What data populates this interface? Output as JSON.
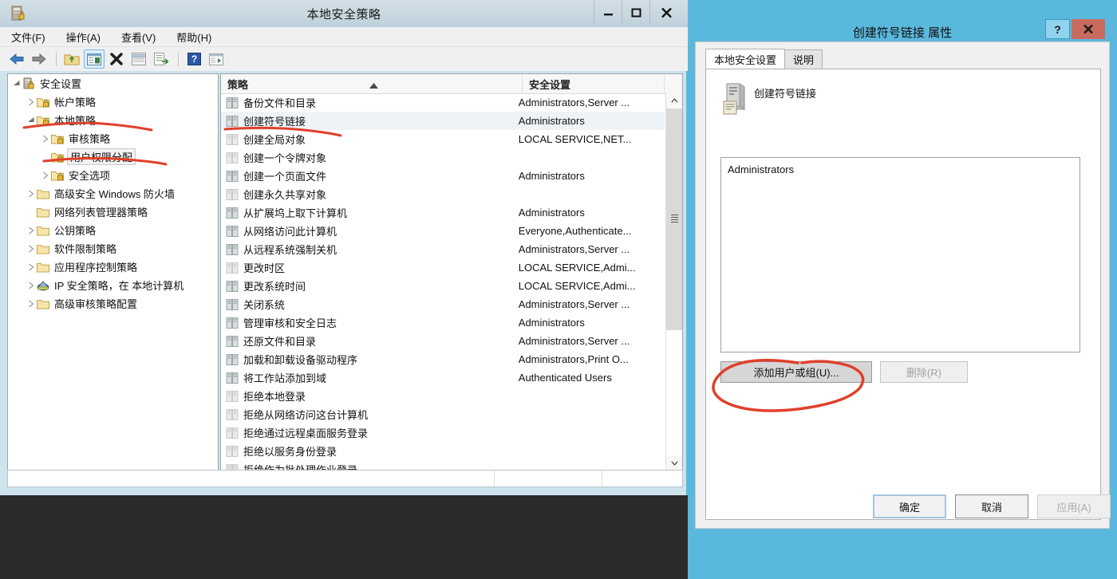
{
  "main_window": {
    "title": "本地安全策略",
    "title_icon": "security-policy-icon",
    "controls": {
      "minimize": "—",
      "maximize": "❐",
      "close": "✕"
    },
    "menu": [
      {
        "label": "文件(F)"
      },
      {
        "label": "操作(A)"
      },
      {
        "label": "查看(V)"
      },
      {
        "label": "帮助(H)"
      }
    ],
    "toolbar": [
      {
        "name": "back-icon"
      },
      {
        "name": "forward-icon"
      },
      {
        "name": "up-folder-icon"
      },
      {
        "name": "show-hide-tree-icon"
      },
      {
        "name": "delete-icon"
      },
      {
        "name": "properties-icon"
      },
      {
        "name": "export-list-icon"
      },
      {
        "name": "help-icon"
      },
      {
        "name": "show-action-pane-icon"
      }
    ],
    "tree": [
      {
        "label": "安全设置",
        "level": 0,
        "twisty": "expanded",
        "icon": "security-settings-icon",
        "selected": false
      },
      {
        "label": "帐户策略",
        "level": 1,
        "twisty": "collapsed",
        "icon": "policy-folder-icon",
        "selected": false
      },
      {
        "label": "本地策略",
        "level": 1,
        "twisty": "expanded",
        "icon": "policy-folder-icon",
        "selected": false
      },
      {
        "label": "审核策略",
        "level": 2,
        "twisty": "collapsed",
        "icon": "policy-folder-icon",
        "selected": false
      },
      {
        "label": "用户权限分配",
        "level": 2,
        "twisty": "none",
        "icon": "policy-folder-icon",
        "selected": true
      },
      {
        "label": "安全选项",
        "level": 2,
        "twisty": "collapsed",
        "icon": "policy-folder-icon",
        "selected": false
      },
      {
        "label": "高级安全 Windows 防火墙",
        "level": 1,
        "twisty": "collapsed",
        "icon": "folder-icon",
        "selected": false
      },
      {
        "label": "网络列表管理器策略",
        "level": 1,
        "twisty": "none",
        "icon": "folder-icon",
        "selected": false
      },
      {
        "label": "公钥策略",
        "level": 1,
        "twisty": "collapsed",
        "icon": "folder-icon",
        "selected": false
      },
      {
        "label": "软件限制策略",
        "level": 1,
        "twisty": "collapsed",
        "icon": "folder-icon",
        "selected": false
      },
      {
        "label": "应用程序控制策略",
        "level": 1,
        "twisty": "collapsed",
        "icon": "folder-icon",
        "selected": false
      },
      {
        "label": "IP 安全策略，在 本地计算机",
        "level": 1,
        "twisty": "collapsed",
        "icon": "ip-security-icon",
        "selected": false
      },
      {
        "label": "高级审核策略配置",
        "level": 1,
        "twisty": "collapsed",
        "icon": "folder-icon",
        "selected": false
      }
    ],
    "list": {
      "columns": [
        "策略",
        "安全设置"
      ],
      "sort": {
        "column": "策略",
        "direction": "ascending"
      },
      "rows": [
        {
          "policy": "备份文件和目录",
          "setting": "Administrators,Server ...",
          "icon": "policy-set-icon",
          "selected": false
        },
        {
          "policy": "创建符号链接",
          "setting": "Administrators",
          "icon": "policy-set-icon",
          "selected": true
        },
        {
          "policy": "创建全局对象",
          "setting": "LOCAL SERVICE,NET...",
          "icon": "policy-empty-icon",
          "selected": false
        },
        {
          "policy": "创建一个令牌对象",
          "setting": "",
          "icon": "policy-empty-icon",
          "selected": false
        },
        {
          "policy": "创建一个页面文件",
          "setting": "Administrators",
          "icon": "policy-set-icon",
          "selected": false
        },
        {
          "policy": "创建永久共享对象",
          "setting": "",
          "icon": "policy-empty-icon",
          "selected": false
        },
        {
          "policy": "从扩展坞上取下计算机",
          "setting": "Administrators",
          "icon": "policy-set-icon",
          "selected": false
        },
        {
          "policy": "从网络访问此计算机",
          "setting": "Everyone,Authenticate...",
          "icon": "policy-set-icon",
          "selected": false
        },
        {
          "policy": "从远程系统强制关机",
          "setting": "Administrators,Server ...",
          "icon": "policy-set-icon",
          "selected": false
        },
        {
          "policy": "更改时区",
          "setting": "LOCAL SERVICE,Admi...",
          "icon": "policy-empty-icon",
          "selected": false
        },
        {
          "policy": "更改系统时间",
          "setting": "LOCAL SERVICE,Admi...",
          "icon": "policy-set-icon",
          "selected": false
        },
        {
          "policy": "关闭系统",
          "setting": "Administrators,Server ...",
          "icon": "policy-set-icon",
          "selected": false
        },
        {
          "policy": "管理审核和安全日志",
          "setting": "Administrators",
          "icon": "policy-set-icon",
          "selected": false
        },
        {
          "policy": "还原文件和目录",
          "setting": "Administrators,Server ...",
          "icon": "policy-set-icon",
          "selected": false
        },
        {
          "policy": "加载和卸载设备驱动程序",
          "setting": "Administrators,Print O...",
          "icon": "policy-set-icon",
          "selected": false
        },
        {
          "policy": "将工作站添加到域",
          "setting": "Authenticated Users",
          "icon": "policy-set-icon",
          "selected": false
        },
        {
          "policy": "拒绝本地登录",
          "setting": "",
          "icon": "policy-empty-icon",
          "selected": false
        },
        {
          "policy": "拒绝从网络访问这台计算机",
          "setting": "",
          "icon": "policy-empty-icon",
          "selected": false
        },
        {
          "policy": "拒绝通过远程桌面服务登录",
          "setting": "",
          "icon": "policy-empty-icon",
          "selected": false
        },
        {
          "policy": "拒绝以服务身份登录",
          "setting": "",
          "icon": "policy-empty-icon",
          "selected": false
        },
        {
          "policy": "拒绝作为批处理作业登录",
          "setting": "",
          "icon": "policy-empty-icon",
          "selected": false
        }
      ],
      "scrollbar": {
        "up_arrow": "▲",
        "down_arrow": "▼"
      }
    },
    "status_bar": {
      "pane1": "",
      "pane2": "",
      "pane3": ""
    }
  },
  "dialog": {
    "title": "创建符号链接 属性",
    "controls": {
      "help": "?",
      "close": "✕"
    },
    "tabs": [
      {
        "label": "本地安全设置",
        "active": true
      },
      {
        "label": "说明",
        "active": false
      }
    ],
    "policy_icon": "server-policy-icon",
    "policy_name": "创建符号链接",
    "members": [
      "Administrators"
    ],
    "buttons": {
      "add": "添加用户或组(U)...",
      "remove": "删除(R)",
      "ok": "确定",
      "cancel": "取消",
      "apply": "应用(A)"
    }
  },
  "annotations": {
    "color": "#e0402a",
    "marks": [
      "underline-local-policies",
      "underline-user-rights-assignment",
      "underline-create-symbolic-links",
      "ellipse-add-user-or-group-button"
    ]
  },
  "colors": {
    "dialog_frame": "#5bb8dd",
    "dialog_close": "#c86a5e",
    "desktop": "#2b2b2b",
    "selection": "#eef3f7",
    "annotation_red": "#e0402a"
  }
}
